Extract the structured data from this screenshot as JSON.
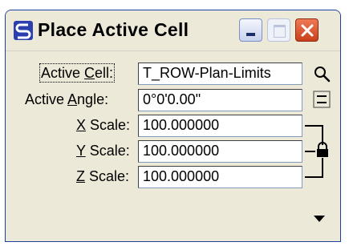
{
  "window": {
    "title": "Place Active Cell",
    "buttons": {
      "minimize": "minimize",
      "maximize": "maximize",
      "close": "close"
    }
  },
  "fields": {
    "active_cell": {
      "label_pre": "Active ",
      "label_key": "C",
      "label_post": "ell:",
      "value": "T_ROW-Plan-Limits"
    },
    "active_angle": {
      "label_pre": "Active ",
      "label_key": "A",
      "label_post": "ngle:",
      "value": "0°0'0.00\""
    },
    "x_scale": {
      "label_key": "X",
      "label_post": " Scale:",
      "value": "100.000000"
    },
    "y_scale": {
      "label_key": "Y",
      "label_post": " Scale:",
      "value": "100.000000"
    },
    "z_scale": {
      "label_key": "Z",
      "label_post": " Scale:",
      "value": "100.000000"
    }
  },
  "icons": {
    "browse": "search-icon",
    "angle_spinner": "spinner-icon",
    "scale_lock": "lock-icon",
    "expand": "triangle-down-icon"
  },
  "colors": {
    "title_border": "#1f3f9c",
    "close": "#d8502a",
    "panel": "#ece9d8"
  }
}
